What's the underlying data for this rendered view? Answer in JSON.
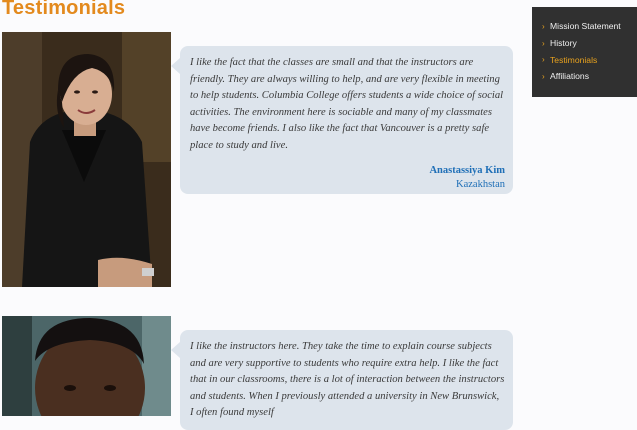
{
  "page": {
    "title": "Testimonials"
  },
  "side_nav": {
    "items": [
      {
        "label": "Mission Statement",
        "active": false
      },
      {
        "label": "History",
        "active": false
      },
      {
        "label": "Testimonials",
        "active": true
      },
      {
        "label": "Affiliations",
        "active": false
      }
    ],
    "chevron": "›"
  },
  "testimonials": [
    {
      "quote": "I like the fact that the classes are small and that the instructors are friendly. They are always willing to help, and are very flexible in meeting to help students. Columbia College offers students a wide choice of social activities. The environment here is sociable and many of my classmates have become friends. I also like the fact that Vancouver is a pretty safe place to study and live.",
      "name": "Anastassiya Kim",
      "country": "Kazakhstan"
    },
    {
      "quote": "I like the instructors here. They take the time to explain course subjects and are very supportive to students who require extra help. I like the fact that in our classrooms, there is a lot of interaction between the instructors and students. When I previously attended a university in New Brunswick, I often found myself"
    }
  ],
  "colors": {
    "title": "#e38a1e",
    "accent": "#e8a21e",
    "nav_bg": "#303030",
    "quote_bg": "#dde4ec",
    "author": "#1f6fb7"
  }
}
